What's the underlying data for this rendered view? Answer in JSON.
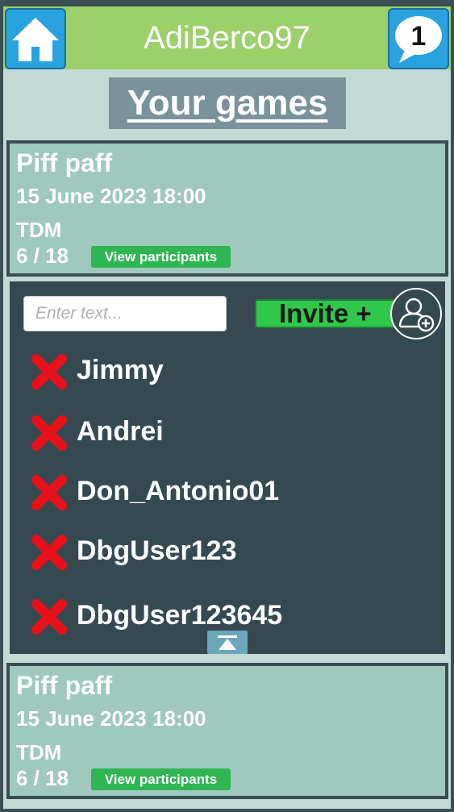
{
  "header": {
    "username": "AdiBerco97",
    "message_count": "1",
    "home_icon": "home-icon",
    "message_icon": "speech-bubble-icon"
  },
  "page_title": "Your games",
  "games": [
    {
      "name": "Piff paff",
      "date": "15 June 2023 18:00",
      "mode": "TDM",
      "participants": "6 / 18",
      "view_label": "View participants"
    },
    {
      "name": "Piff paff",
      "date": "15 June 2023 18:00",
      "mode": "TDM",
      "participants": "6 / 18",
      "view_label": "View participants"
    }
  ],
  "invite_panel": {
    "search_placeholder": "Enter text...",
    "invite_label": "Invite +",
    "participants": [
      "Jimmy",
      "Andrei",
      "Don_Antonio01",
      "DbgUser123",
      "DbgUser123645"
    ],
    "remove_icon": "red-x-icon",
    "add_user_icon": "add-user-icon",
    "scroll_top_icon": "scroll-to-top-icon"
  },
  "colors": {
    "header": "#9bd06b",
    "button_blue": "#2aa2e0",
    "card": "#9fc8bf",
    "panel": "#364951",
    "green": "#2fb551",
    "remove_red": "#e8101a"
  }
}
